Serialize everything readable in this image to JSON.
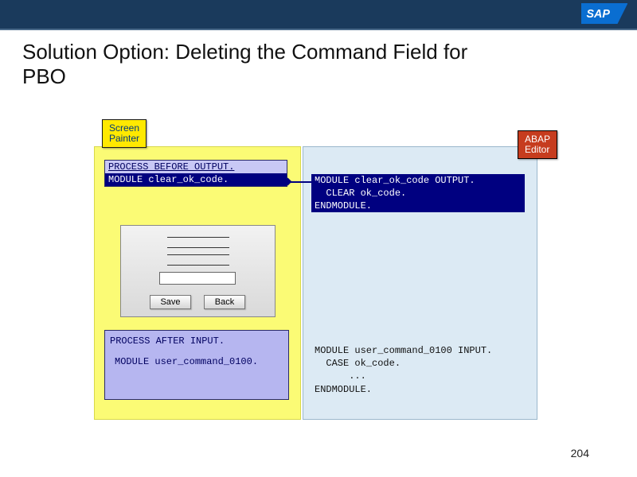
{
  "header": {
    "brand": "SAP"
  },
  "title_line1": "Solution Option: Deleting the Command Field for",
  "title_line2": "PBO",
  "screen_painter": {
    "label_l1": "Screen",
    "label_l2": "Painter",
    "pbo_l1": "PROCESS BEFORE OUTPUT.",
    "pbo_l2": "MODULE clear_ok_code.",
    "save": "Save",
    "back": "Back",
    "pai_l1": "PROCESS AFTER INPUT.",
    "pai_l2": "MODULE user_command_0100."
  },
  "abap_editor": {
    "label_l1": "ABAP",
    "label_l2": "Editor",
    "mod_l1": "MODULE clear_ok_code OUTPUT.",
    "mod_l2": "  CLEAR ok_code.",
    "mod_l3": "ENDMODULE.",
    "lower_l1": "MODULE user_command_0100 INPUT.",
    "lower_l2": "  CASE ok_code.",
    "lower_l3": "      ...",
    "lower_l4": "ENDMODULE."
  },
  "page_number": "204"
}
